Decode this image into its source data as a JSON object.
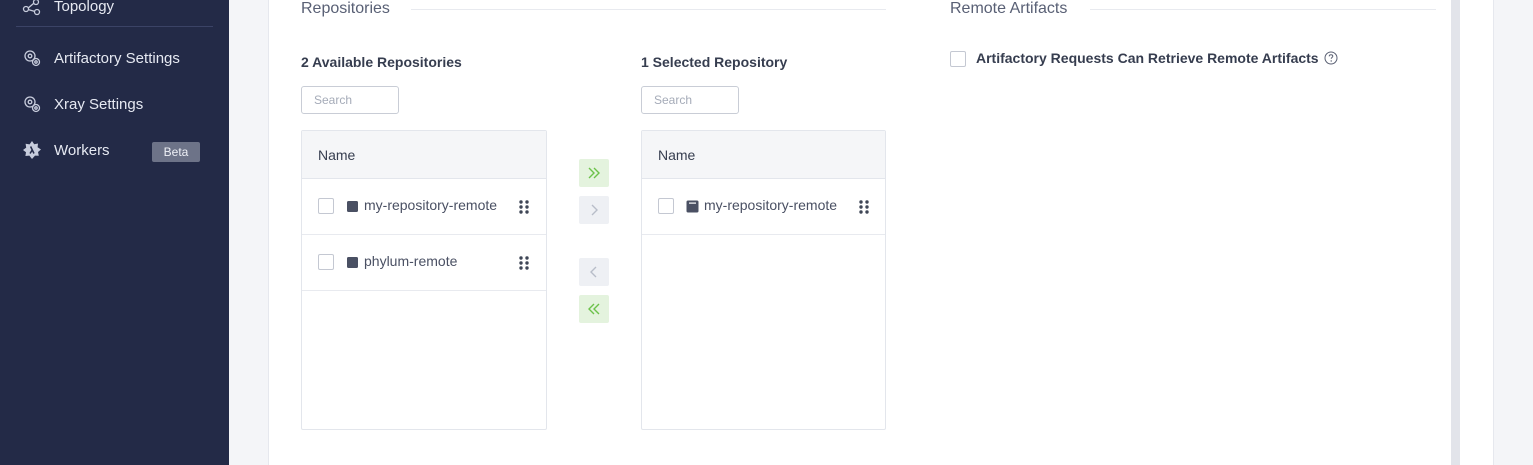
{
  "sidebar": {
    "items": [
      {
        "label": "Topology",
        "icon": "topology-icon"
      },
      {
        "label": "Artifactory Settings",
        "icon": "settings-gear-icon"
      },
      {
        "label": "Xray Settings",
        "icon": "settings-gear-icon"
      },
      {
        "label": "Workers",
        "icon": "workers-icon",
        "badge": "Beta"
      }
    ]
  },
  "repositories": {
    "section_title": "Repositories",
    "available": {
      "title": "2 Available Repositories",
      "search_placeholder": "Search",
      "column_header": "Name",
      "rows": [
        {
          "name": "my-repository-remote",
          "icon": "remote-repo-icon"
        },
        {
          "name": "phylum-remote",
          "icon": "remote-repo-icon"
        }
      ]
    },
    "transfer_buttons": [
      {
        "name": "move-all-right",
        "glyph": "»"
      },
      {
        "name": "move-right",
        "glyph": "›"
      },
      {
        "name": "move-left",
        "glyph": "‹"
      },
      {
        "name": "move-all-left",
        "glyph": "«"
      }
    ],
    "selected": {
      "title": "1 Selected Repository",
      "search_placeholder": "Search",
      "column_header": "Name",
      "rows": [
        {
          "name": "my-repository-remote",
          "icon": "local-repo-icon"
        }
      ]
    }
  },
  "remote_artifacts": {
    "section_title": "Remote Artifacts",
    "checkbox_label": "Artifactory Requests Can Retrieve Remote Artifacts",
    "checked": false
  },
  "colors": {
    "sidebar_bg": "#232a47",
    "accent_green": "#6cc24a",
    "badge_bg": "#6d7388"
  }
}
